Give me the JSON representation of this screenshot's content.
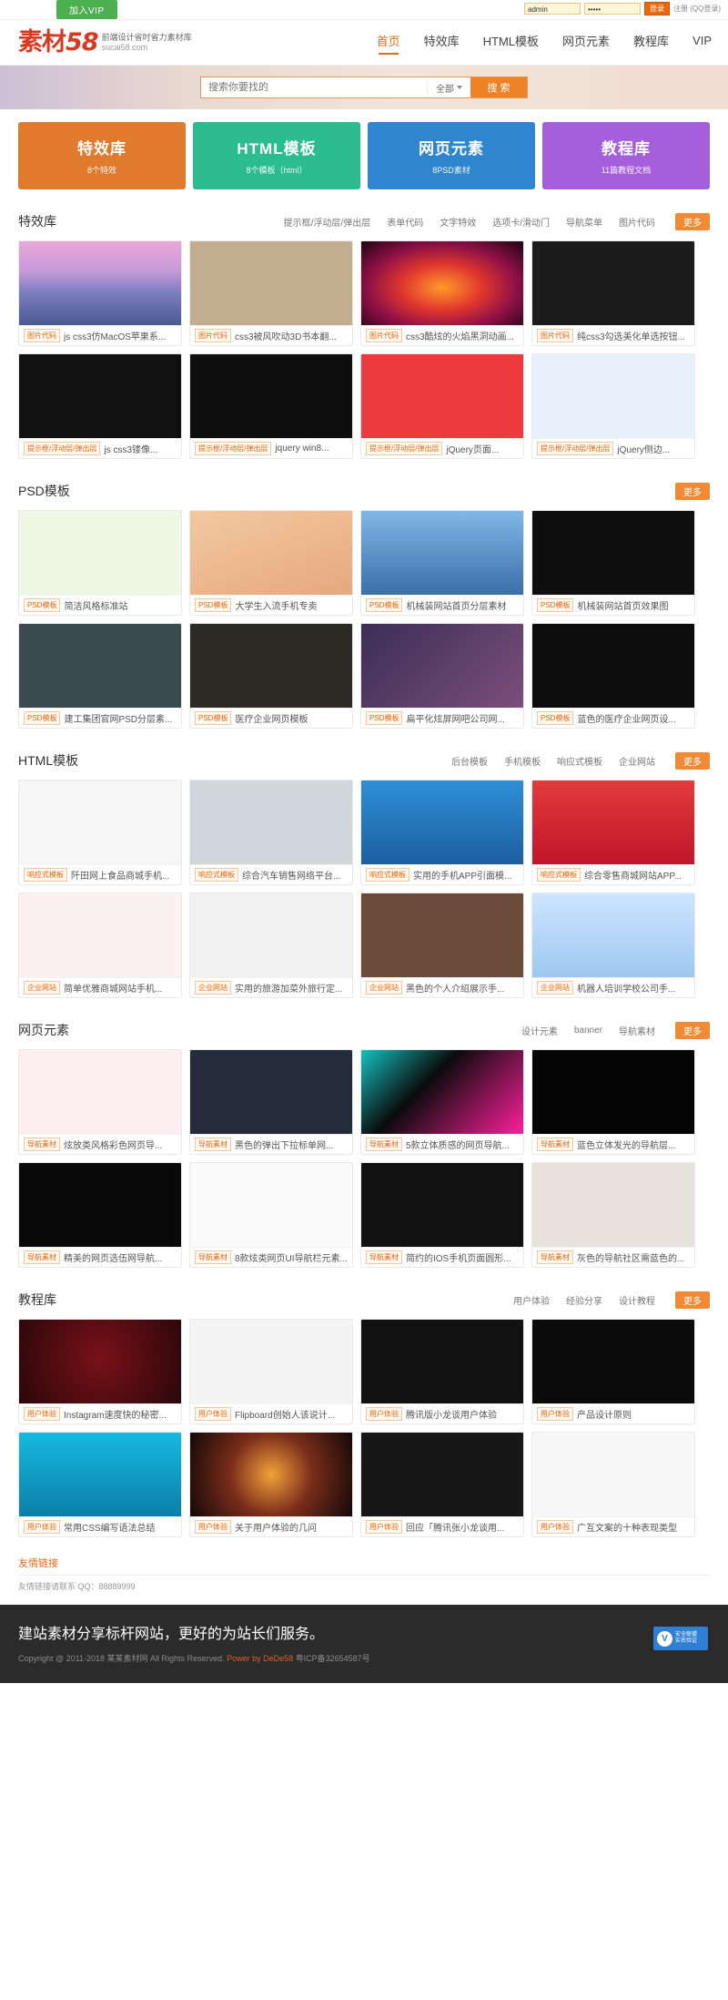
{
  "topbar": {
    "vip_label": "加入VIP",
    "username_value": "admin",
    "password_value": "•••••",
    "login_label": "登录",
    "register_label": "注册 (QQ登录)"
  },
  "header": {
    "logo_text": "素材",
    "logo_number": "58",
    "logo_sub1": "前端设计省时省力素材库",
    "logo_sub2": "sucai58.com",
    "nav": [
      {
        "label": "首页",
        "active": true
      },
      {
        "label": "特效库",
        "active": false
      },
      {
        "label": "HTML模板",
        "active": false
      },
      {
        "label": "网页元素",
        "active": false
      },
      {
        "label": "教程库",
        "active": false
      },
      {
        "label": "VIP",
        "active": false
      }
    ]
  },
  "search": {
    "placeholder": "搜索你要找的",
    "scope_value": "全部",
    "button_label": "搜 索"
  },
  "banners": [
    {
      "title": "特效库",
      "subtitle": "8个特效",
      "color": "#e07b2e"
    },
    {
      "title": "HTML模板",
      "subtitle": "8个模板（html）",
      "color": "#2bbd8e"
    },
    {
      "title": "网页元素",
      "subtitle": "8PSD素材",
      "color": "#2f86ce"
    },
    {
      "title": "教程库",
      "subtitle": "11篇教程文档",
      "color": "#a55fdb"
    }
  ],
  "sections": [
    {
      "title": "特效库",
      "nav": [
        "提示框/浮动层/弹出层",
        "表单代码",
        "文字特效",
        "选项卡/滑动门",
        "导航菜单",
        "图片代码"
      ],
      "more_label": "更多",
      "cards": [
        {
          "tag": "图片代码",
          "text": "js css3仿MacOS苹果系...",
          "art": "a-mountain"
        },
        {
          "tag": "图片代码",
          "text": "css3被风吹动3D书本翻...",
          "art": "a-book"
        },
        {
          "tag": "图片代码",
          "text": "css3酷炫的火焰黑洞动画...",
          "art": "a-fire"
        },
        {
          "tag": "图片代码",
          "text": "纯css3勾选美化单选按钮...",
          "art": "a-dark"
        },
        {
          "tag": "提示框/浮动层/弹出层",
          "text": "js css3镂像...",
          "art": "a-darker"
        },
        {
          "tag": "提示框/浮动层/弹出层",
          "text": "jquery win8...",
          "art": "a-blackui"
        },
        {
          "tag": "提示框/浮动层/弹出层",
          "text": "jQuery页面...",
          "art": "a-red"
        },
        {
          "tag": "提示框/浮动层/弹出层",
          "text": "jQuery侧边...",
          "art": "a-lightblue"
        }
      ]
    },
    {
      "title": "PSD模板",
      "nav": [],
      "more_label": "更多",
      "cards": [
        {
          "tag": "PSD模板",
          "text": "简洁风格标准站",
          "art": "a-frog"
        },
        {
          "tag": "PSD模板",
          "text": "大学生入流手机专卖",
          "art": "a-weather"
        },
        {
          "tag": "PSD模板",
          "text": "机械装网站首页分层素材",
          "art": "a-mech"
        },
        {
          "tag": "PSD模板",
          "text": "机械装网站首页效果图",
          "art": "a-blackui"
        },
        {
          "tag": "PSD模板",
          "text": "建工集团官网PSD分层素...",
          "art": "a-chalk"
        },
        {
          "tag": "PSD模板",
          "text": "医疗企业网页模板",
          "art": "a-clinic"
        },
        {
          "tag": "PSD模板",
          "text": "扁平化炫屏网吧公司网...",
          "art": "a-purple"
        },
        {
          "tag": "PSD模板",
          "text": "蓝色的医疗企业网页设...",
          "art": "a-timer"
        }
      ]
    },
    {
      "title": "HTML模板",
      "nav": [
        "后台模板",
        "手机模板",
        "响应式模板",
        "企业网站"
      ],
      "more_label": "更多",
      "cards": [
        {
          "tag": "响应式模板",
          "text": "阡田网上食品商城手机...",
          "art": "a-shop"
        },
        {
          "tag": "响应式模板",
          "text": "综合汽车销售网络平台...",
          "art": "a-person"
        },
        {
          "tag": "响应式模板",
          "text": "实用的手机APP引面模...",
          "art": "a-blue"
        },
        {
          "tag": "响应式模板",
          "text": "综合零售商城网站APP...",
          "art": "a-promo"
        },
        {
          "tag": "企业网站",
          "text": "简单优雅商城网站手机...",
          "art": "a-pastel"
        },
        {
          "tag": "企业网站",
          "text": "实用的旅游加菜外旅行定...",
          "art": "a-chat"
        },
        {
          "tag": "企业网站",
          "text": "黑色的个人介绍展示手...",
          "art": "a-brown"
        },
        {
          "tag": "企业网站",
          "text": "机器人培训学校公司手...",
          "art": "a-festival"
        }
      ]
    },
    {
      "title": "网页元素",
      "nav": [
        "设计元素",
        "banner",
        "导航素材"
      ],
      "more_label": "更多",
      "cards": [
        {
          "tag": "导航素材",
          "text": "炫放类风格彩色网页导...",
          "art": "a-lotus"
        },
        {
          "tag": "导航素材",
          "text": "黑色的弹出下拉标单网...",
          "art": "a-navy"
        },
        {
          "tag": "导航素材",
          "text": "5款立体质感的网页导航...",
          "art": "a-magenta"
        },
        {
          "tag": "导航素材",
          "text": "蓝色立体发光的导航层...",
          "art": "a-neon"
        },
        {
          "tag": "导航素材",
          "text": "精美的网页选伍网导航...",
          "art": "a-robot"
        },
        {
          "tag": "导航素材",
          "text": "8款炫类网页UI导航栏元素...",
          "art": "a-choice"
        },
        {
          "tag": "导航素材",
          "text": "简约的IOS手机页面圆形...",
          "art": "a-dots"
        },
        {
          "tag": "导航素材",
          "text": "灰色的导航社区需蓝色的...",
          "art": "a-coffee"
        }
      ]
    },
    {
      "title": "教程库",
      "nav": [
        "用户体验",
        "经验分享",
        "设计教程"
      ],
      "more_label": "更多",
      "cards": [
        {
          "tag": "用户体验",
          "text": "Instagram速度快的秘密...",
          "art": "a-seven"
        },
        {
          "tag": "用户体验",
          "text": "Flipboard创始人该说计...",
          "art": "a-flip"
        },
        {
          "tag": "用户体验",
          "text": "腾讯版小龙谈用户体验",
          "art": "a-clock"
        },
        {
          "tag": "用户体验",
          "text": "产品设计原则",
          "art": "a-oadi"
        },
        {
          "tag": "用户体验",
          "text": "常用CSS编写语法总结",
          "art": "a-cyan"
        },
        {
          "tag": "用户体验",
          "text": "关于用户体验的几问",
          "art": "a-space"
        },
        {
          "tag": "用户体验",
          "text": "回应「腾讯张小龙谈用...",
          "art": "a-gauge"
        },
        {
          "tag": "用户体验",
          "text": "广互文案的十种表现类型",
          "art": "a-wire"
        }
      ]
    }
  ],
  "friend_links": {
    "title": "友情链接",
    "body": "友情链接请联系 QQ：88889999"
  },
  "footer": {
    "slogan": "建站素材分享标杆网站，更好的为站长们服务。",
    "copyright_prefix": "Copyright @ 2011-2018 某某素材网 All Rights Reserved.",
    "power": "Power by DeDe58",
    "icp": "粤ICP备32654587号",
    "badge_line1": "安全联盟",
    "badge_line2": "实名验证",
    "badge_mark": "V"
  }
}
